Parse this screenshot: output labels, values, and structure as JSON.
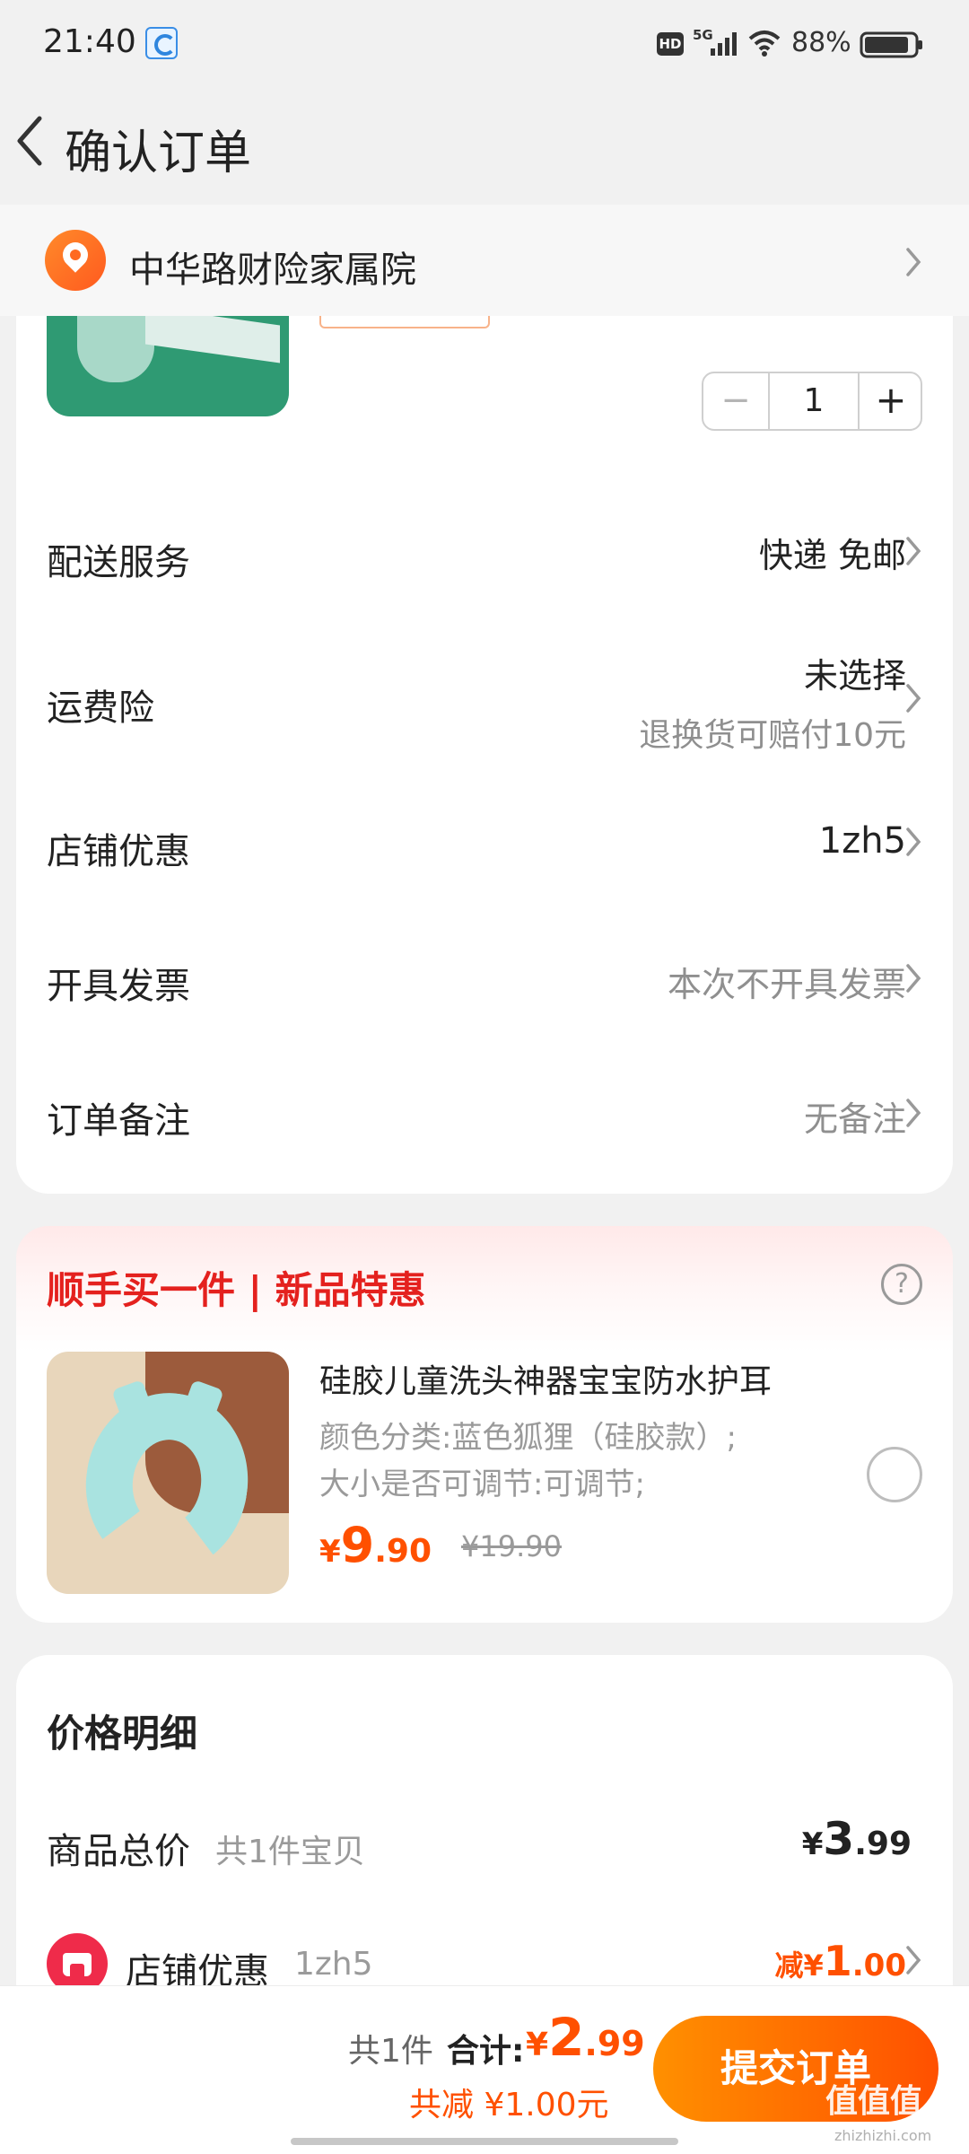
{
  "status_bar": {
    "time": "21:40",
    "network": "5G",
    "hd_badge": "HD",
    "battery": "88%",
    "icons": [
      "app-icon",
      "hd-icon",
      "signal-icon",
      "wifi-icon",
      "battery-icon"
    ]
  },
  "header": {
    "title": "确认订单",
    "back_icon": "back-icon"
  },
  "address": {
    "text": "中华路财险家属院",
    "icon": "location-icon"
  },
  "order": {
    "quantity": "1",
    "minus_label": "−",
    "plus_label": "+",
    "rows": [
      {
        "label": "配送服务",
        "value": "快递 免邮"
      },
      {
        "label": "运费险",
        "value": "未选择",
        "sub": "退换货可赔付10元"
      },
      {
        "label": "店铺优惠",
        "value": "1zh5"
      },
      {
        "label": "开具发票",
        "value": "本次不开具发票"
      },
      {
        "label": "订单备注",
        "value": "无备注"
      }
    ]
  },
  "addon": {
    "title": "顺手买一件 | 新品特惠",
    "help": "?",
    "product_name": "硅胶儿童洗头神器宝宝防水护耳",
    "spec_line1": "颜色分类:蓝色狐狸（硅胶款）;",
    "spec_line2": "大小是否可调节:可调节;",
    "price_currency": "¥",
    "price_int": "9",
    "price_dec": ".90",
    "original_price": "¥19.90",
    "selected": false
  },
  "price_detail": {
    "title": "价格明细",
    "subtotal_label": "商品总价",
    "subtotal_count": "共1件宝贝",
    "subtotal_currency": "¥",
    "subtotal_int": "3",
    "subtotal_dec": ".99",
    "shop_discount_label": "店铺优惠",
    "shop_discount_code": "1zh5",
    "shop_discount_prefix": "减",
    "shop_discount_currency": "¥",
    "shop_discount_int": "1",
    "shop_discount_dec": ".00"
  },
  "bottom_bar": {
    "count": "共1件",
    "total_label": "合计:",
    "total_currency": "¥",
    "total_int": "2",
    "total_dec": ".99",
    "discount_text": "共减 ¥1.00元",
    "submit_label": "提交订单"
  },
  "watermark": {
    "text": "值值值",
    "sub": "zhizhizhi.com"
  },
  "colors": {
    "accent": "#ff5000",
    "addon_title": "#e4211e",
    "submit_gradient_start": "#ff9000",
    "submit_gradient_end": "#ff5000",
    "page_bg": "#f1f1f1"
  }
}
